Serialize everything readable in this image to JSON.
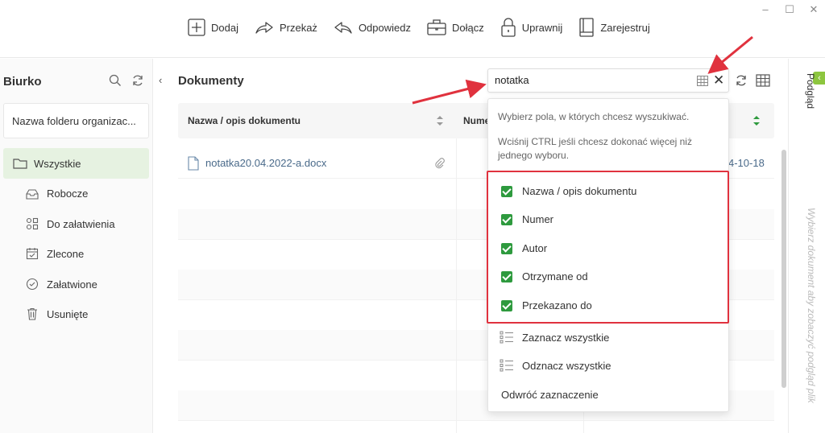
{
  "window": {
    "minimize_glyph": "–",
    "maximize_glyph": "☐",
    "close_glyph": "✕"
  },
  "toolbar": {
    "items": [
      {
        "label": "Dodaj",
        "icon": "plus-square-icon"
      },
      {
        "label": "Przekaż",
        "icon": "forward-arrow-icon"
      },
      {
        "label": "Odpowiedz",
        "icon": "reply-arrow-icon"
      },
      {
        "label": "Dołącz",
        "icon": "briefcase-icon"
      },
      {
        "label": "Uprawnij",
        "icon": "lock-icon"
      },
      {
        "label": "Zarejestruj",
        "icon": "register-book-icon"
      }
    ]
  },
  "sidebar": {
    "title": "Biurko",
    "folder_select": "Nazwa folderu organizac...",
    "items": [
      {
        "label": "Wszystkie",
        "icon": "folder-icon",
        "active": true
      },
      {
        "label": "Robocze",
        "icon": "inbox-icon"
      },
      {
        "label": "Do załatwienia",
        "icon": "tasks-icon"
      },
      {
        "label": "Zlecone",
        "icon": "calendar-icon"
      },
      {
        "label": "Załatwione",
        "icon": "check-circle-icon"
      },
      {
        "label": "Usunięte",
        "icon": "trash-icon"
      }
    ]
  },
  "main": {
    "title": "Dokumenty",
    "columns": {
      "name": "Nazwa / opis dokumentu",
      "number": "Nume"
    },
    "rows": [
      {
        "name": "notatka20.04.2022-a.docx",
        "date": "4-10-18"
      }
    ]
  },
  "search": {
    "value": "notatka",
    "placeholder": "",
    "hint": "Wybierz pola, w których chcesz wyszukiwać.",
    "ctrl_hint": "Wciśnij CTRL jeśli chcesz dokonać więcej niż jednego wyboru.",
    "fields": [
      {
        "label": "Nazwa / opis dokumentu",
        "checked": true
      },
      {
        "label": "Numer",
        "checked": true
      },
      {
        "label": "Autor",
        "checked": true
      },
      {
        "label": "Otrzymane od",
        "checked": true
      },
      {
        "label": "Przekazano do",
        "checked": true
      }
    ],
    "select_all": "Zaznacz wszystkie",
    "deselect_all": "Odznacz wszystkie",
    "invert": "Odwróć zaznaczenie"
  },
  "preview": {
    "label": "Podgląd",
    "hint": "Wybierz dokument aby zobaczyć podgląd plik"
  },
  "colors": {
    "accent": "#2e9a3e",
    "active_bg": "#e6f2e1",
    "highlight": "#e0323e",
    "link": "#4a6a8a"
  }
}
